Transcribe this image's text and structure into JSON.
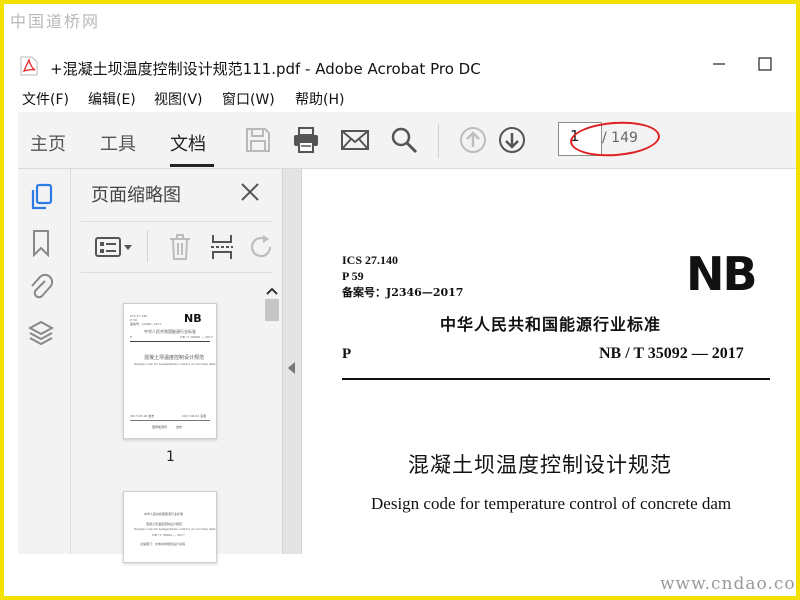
{
  "watermark": {
    "top": "中国道桥网",
    "bottom": "www.cndao.com"
  },
  "window": {
    "title": "+混凝土坝温度控制设计规范111.pdf - Adobe Acrobat Pro DC"
  },
  "menu": [
    {
      "label": "文件(F)"
    },
    {
      "label": "编辑(E)"
    },
    {
      "label": "视图(V)"
    },
    {
      "label": "窗口(W)"
    },
    {
      "label": "帮助(H)"
    }
  ],
  "tabs": [
    {
      "label": "主页"
    },
    {
      "label": "工具"
    },
    {
      "label": "文档",
      "active": true
    }
  ],
  "toolbar_icons": [
    "save-icon",
    "print-icon",
    "mail-icon",
    "search-icon",
    "arrow-up-circle-icon",
    "arrow-down-circle-icon"
  ],
  "page_nav": {
    "current": "1",
    "total": "/ 149"
  },
  "left_rail_icons": [
    "pages-icon",
    "bookmark-icon",
    "attachment-icon",
    "layers-icon"
  ],
  "thumbnail_panel": {
    "title": "页面缩略图",
    "tool_icons": [
      "thumbnail-options-icon",
      "delete-icon",
      "insert-page-icon",
      "rotate-icon"
    ],
    "thumb1": {
      "ics": "ICS 27.140",
      "p": "P 59",
      "record": "备案号：J2346—2017",
      "logo": "NB",
      "issuer": "中华人民共和国能源行业标准",
      "code_p": "P",
      "code": "NB / T  35092 — 2017",
      "cn_title": "混凝土坝温度控制设计规范",
      "en_title": "Design code for temperature control of concrete dam",
      "issue_date": "2017-03-28 发布",
      "impl_date": "2017-08-01 实施",
      "publisher": "国家能源局",
      "publisher_suffix": "发布"
    },
    "thumb2": {
      "issuer": "中华人民共和国能源行业标准",
      "cn_title": "混凝土坝温度控制设计规范",
      "en_title": "Design code for temperature control of concrete dam",
      "code": "NB / T 35092 — 2017",
      "line": "主编部门：水电水利规划设计总院"
    },
    "page_label": "1"
  },
  "document": {
    "ics": "ICS 27.140",
    "p": "P 59",
    "record": "备案号：J2346—2017",
    "logo": "NB",
    "issuer": "中华人民共和国能源行业标准",
    "code_p": "P",
    "code": "NB / T  35092 — 2017",
    "cn_title": "混凝土坝温度控制设计规范",
    "en_title": "Design code for temperature control of concrete dam"
  },
  "colors": {
    "highlight": "#e02020",
    "background": "#f2e200"
  }
}
